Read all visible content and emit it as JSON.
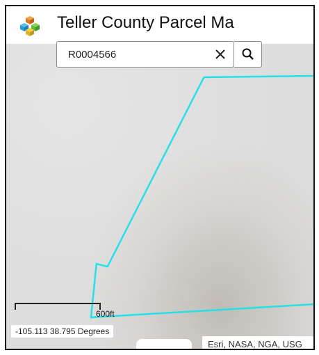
{
  "header": {
    "title": "Teller County Parcel Ma"
  },
  "search": {
    "value": "R0004566"
  },
  "map": {
    "scale_label": "600ft",
    "coordinates": "-105.113 38.795 Degrees",
    "attribution": "Esri, NASA, NGA, USG"
  },
  "colors": {
    "parcel_outline": "#25e0e8",
    "frame": "#111111"
  },
  "icons": {
    "app": "stacked-cubes-icon",
    "clear": "close-icon",
    "search": "search-icon"
  }
}
